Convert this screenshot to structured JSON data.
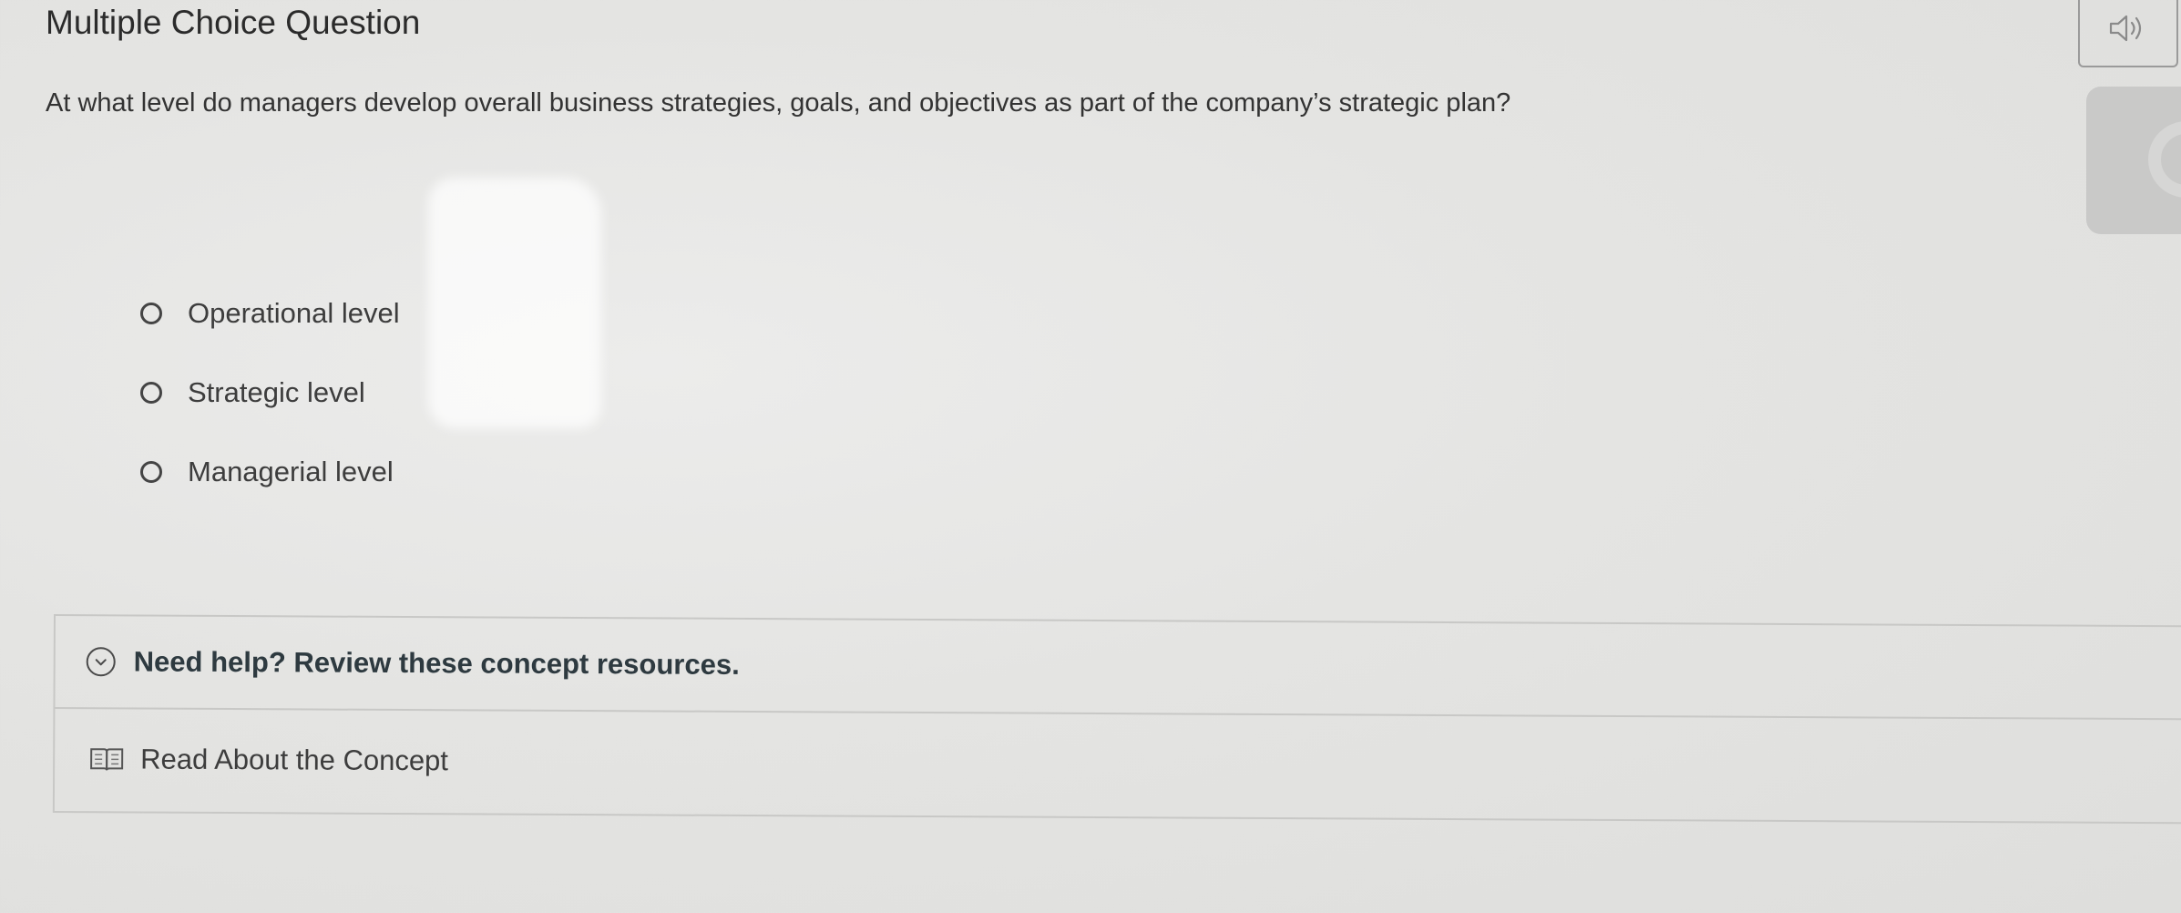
{
  "header": {
    "title": "Multiple Choice Question"
  },
  "question": {
    "text": "At what level do managers develop overall business strategies, goals, and objectives as part of the company’s strategic plan?"
  },
  "choices": [
    {
      "label": "Operational level"
    },
    {
      "label": "Strategic level"
    },
    {
      "label": "Managerial level"
    }
  ],
  "help": {
    "title": "Need help? Review these concept resources.",
    "resource_label": "Read About the Concept"
  },
  "icons": {
    "audio": "speaker-icon",
    "expand": "chevron-down-icon",
    "resource": "book-icon"
  }
}
